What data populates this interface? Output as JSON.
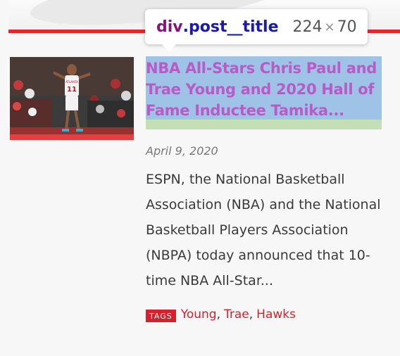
{
  "inspector_tooltip": {
    "tag": "div",
    "class_name": ".post__title",
    "width": "224",
    "times": "×",
    "height": "70"
  },
  "post": {
    "title": "NBA All-Stars Chris Paul and Trae Young and 2020 Hall of Fame Inductee Tamika...",
    "date": "April 9, 2020",
    "excerpt": "ESPN, the National Basketball Association (NBA) and the National Basketball Players Association (NBPA) today announced that 10-time NBA All-Star...",
    "thumbnail_jersey_text": "ATLANTA",
    "thumbnail_jersey_number": "11",
    "tags_label": "TAGS",
    "tags": [
      "Young",
      "Trae",
      "Hawks"
    ],
    "tag_separator": ","
  },
  "colors": {
    "accent_red": "#e0282e",
    "tag_red": "#d6202c",
    "highlight_content": "#9fc2e7",
    "highlight_margin": "#c4dfb6",
    "title_text": "#b85bc7"
  }
}
